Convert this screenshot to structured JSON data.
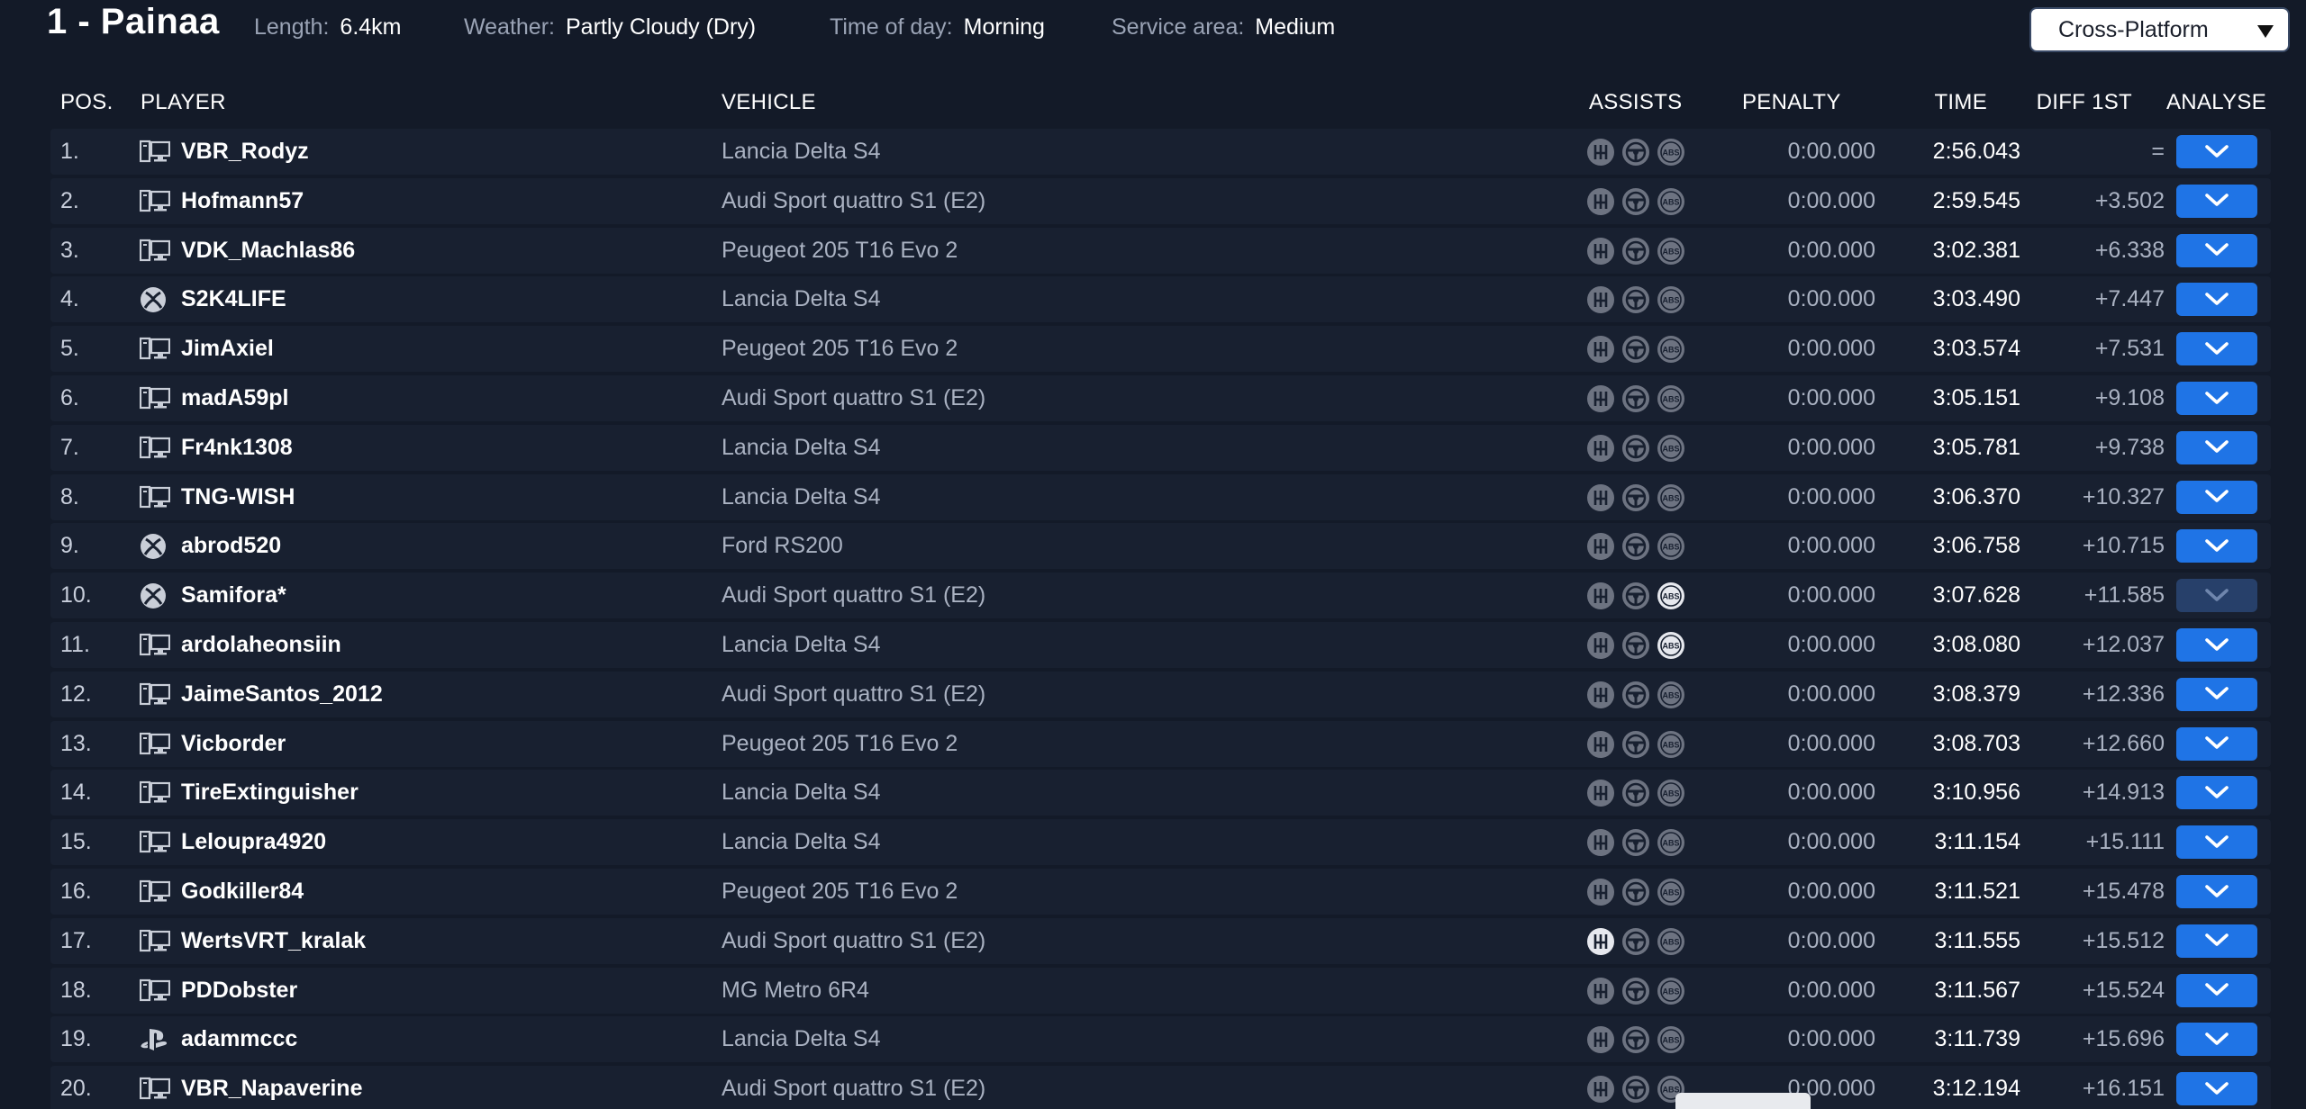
{
  "header": {
    "stage_title": "1 - Painaa",
    "length_label": "Length:",
    "length_value": "6.4km",
    "weather_label": "Weather:",
    "weather_value": "Partly Cloudy (Dry)",
    "time_of_day_label": "Time of day:",
    "time_of_day_value": "Morning",
    "service_area_label": "Service area:",
    "service_area_value": "Medium",
    "platform_filter": "Cross-Platform"
  },
  "columns": {
    "pos": "POS.",
    "player": "PLAYER",
    "vehicle": "VEHICLE",
    "assists": "ASSISTS",
    "penalty": "PENALTY",
    "time": "TIME",
    "diff": "DIFF 1ST",
    "analyse": "ANALYSE"
  },
  "colors": {
    "background": "#131a28",
    "row": "#182030",
    "accent": "#1f74e6",
    "assist_off": "#6d7381",
    "assist_on": "#e6e8ee"
  },
  "rows": [
    {
      "pos": "1.",
      "platform": "pc-icon",
      "player": "VBR_Rodyz",
      "vehicle": "Lancia Delta S4",
      "assists_on": [],
      "penalty": "0:00.000",
      "time": "2:56.043",
      "diff": "=",
      "analyse_active": true
    },
    {
      "pos": "2.",
      "platform": "pc-icon",
      "player": "Hofmann57",
      "vehicle": "Audi Sport quattro S1 (E2)",
      "assists_on": [],
      "penalty": "0:00.000",
      "time": "2:59.545",
      "diff": "+3.502",
      "analyse_active": true
    },
    {
      "pos": "3.",
      "platform": "pc-icon",
      "player": "VDK_Machlas86",
      "vehicle": "Peugeot 205 T16 Evo 2",
      "assists_on": [],
      "penalty": "0:00.000",
      "time": "3:02.381",
      "diff": "+6.338",
      "analyse_active": true
    },
    {
      "pos": "4.",
      "platform": "xbox-icon",
      "player": "S2K4LIFE",
      "vehicle": "Lancia Delta S4",
      "assists_on": [],
      "penalty": "0:00.000",
      "time": "3:03.490",
      "diff": "+7.447",
      "analyse_active": true
    },
    {
      "pos": "5.",
      "platform": "pc-icon",
      "player": "JimAxiel",
      "vehicle": "Peugeot 205 T16 Evo 2",
      "assists_on": [],
      "penalty": "0:00.000",
      "time": "3:03.574",
      "diff": "+7.531",
      "analyse_active": true
    },
    {
      "pos": "6.",
      "platform": "pc-icon",
      "player": "madA59pl",
      "vehicle": "Audi Sport quattro S1 (E2)",
      "assists_on": [],
      "penalty": "0:00.000",
      "time": "3:05.151",
      "diff": "+9.108",
      "analyse_active": true
    },
    {
      "pos": "7.",
      "platform": "pc-icon",
      "player": "Fr4nk1308",
      "vehicle": "Lancia Delta S4",
      "assists_on": [],
      "penalty": "0:00.000",
      "time": "3:05.781",
      "diff": "+9.738",
      "analyse_active": true
    },
    {
      "pos": "8.",
      "platform": "pc-icon",
      "player": "TNG-WISH",
      "vehicle": "Lancia Delta S4",
      "assists_on": [],
      "penalty": "0:00.000",
      "time": "3:06.370",
      "diff": "+10.327",
      "analyse_active": true
    },
    {
      "pos": "9.",
      "platform": "xbox-icon",
      "player": "abrod520",
      "vehicle": "Ford RS200",
      "assists_on": [],
      "penalty": "0:00.000",
      "time": "3:06.758",
      "diff": "+10.715",
      "analyse_active": true
    },
    {
      "pos": "10.",
      "platform": "xbox-icon",
      "player": "Samifora*",
      "vehicle": "Audi Sport quattro S1 (E2)",
      "assists_on": [
        "abs"
      ],
      "penalty": "0:00.000",
      "time": "3:07.628",
      "diff": "+11.585",
      "analyse_active": false
    },
    {
      "pos": "11.",
      "platform": "pc-icon",
      "player": "ardolaheonsiin",
      "vehicle": "Lancia Delta S4",
      "assists_on": [
        "abs"
      ],
      "penalty": "0:00.000",
      "time": "3:08.080",
      "diff": "+12.037",
      "analyse_active": true
    },
    {
      "pos": "12.",
      "platform": "pc-icon",
      "player": "JaimeSantos_2012",
      "vehicle": "Audi Sport quattro S1 (E2)",
      "assists_on": [],
      "penalty": "0:00.000",
      "time": "3:08.379",
      "diff": "+12.336",
      "analyse_active": true
    },
    {
      "pos": "13.",
      "platform": "pc-icon",
      "player": "Vicborder",
      "vehicle": "Peugeot 205 T16 Evo 2",
      "assists_on": [],
      "penalty": "0:00.000",
      "time": "3:08.703",
      "diff": "+12.660",
      "analyse_active": true
    },
    {
      "pos": "14.",
      "platform": "pc-icon",
      "player": "TireExtinguisher",
      "vehicle": "Lancia Delta S4",
      "assists_on": [],
      "penalty": "0:00.000",
      "time": "3:10.956",
      "diff": "+14.913",
      "analyse_active": true
    },
    {
      "pos": "15.",
      "platform": "pc-icon",
      "player": "Leloupra4920",
      "vehicle": "Lancia Delta S4",
      "assists_on": [],
      "penalty": "0:00.000",
      "time": "3:11.154",
      "diff": "+15.111",
      "analyse_active": true
    },
    {
      "pos": "16.",
      "platform": "pc-icon",
      "player": "Godkiller84",
      "vehicle": "Peugeot 205 T16 Evo 2",
      "assists_on": [],
      "penalty": "0:00.000",
      "time": "3:11.521",
      "diff": "+15.478",
      "analyse_active": true
    },
    {
      "pos": "17.",
      "platform": "pc-icon",
      "player": "WertsVRT_kralak",
      "vehicle": "Audi Sport quattro S1 (E2)",
      "assists_on": [
        "gearbox"
      ],
      "penalty": "0:00.000",
      "time": "3:11.555",
      "diff": "+15.512",
      "analyse_active": true
    },
    {
      "pos": "18.",
      "platform": "pc-icon",
      "player": "PDDobster",
      "vehicle": "MG Metro 6R4",
      "assists_on": [],
      "penalty": "0:00.000",
      "time": "3:11.567",
      "diff": "+15.524",
      "analyse_active": true
    },
    {
      "pos": "19.",
      "platform": "playstation-icon",
      "player": "adammccc",
      "vehicle": "Lancia Delta S4",
      "assists_on": [],
      "penalty": "0:00.000",
      "time": "3:11.739",
      "diff": "+15.696",
      "analyse_active": true
    },
    {
      "pos": "20.",
      "platform": "pc-icon",
      "player": "VBR_Napaverine",
      "vehicle": "Audi Sport quattro S1 (E2)",
      "assists_on": [],
      "penalty": "0:00.000",
      "time": "3:12.194",
      "diff": "+16.151",
      "analyse_active": true
    }
  ]
}
